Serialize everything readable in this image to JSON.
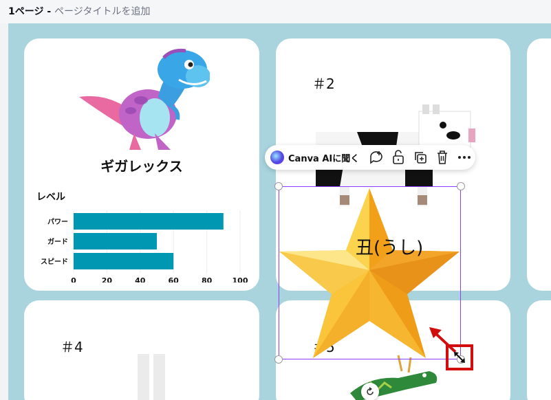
{
  "header": {
    "page_number": "1ページ",
    "separator": " - ",
    "page_title_placeholder": "ページタイトルを追加"
  },
  "cards": {
    "dino": {
      "name": "ギガレックス"
    },
    "card2": {
      "label": "＃2"
    },
    "card4": {
      "label": "＃4"
    },
    "card5": {
      "label": "＃5"
    }
  },
  "star_text": "丑(うし)",
  "toolbar": {
    "ai_label": "Canva AIに聞く",
    "icons": [
      "canva-ai-icon",
      "comment-add-icon",
      "unlock-icon",
      "duplicate-icon",
      "trash-icon",
      "more-icon"
    ]
  },
  "chart_data": {
    "type": "bar",
    "orientation": "horizontal",
    "title": "レベル",
    "categories": [
      "パワー",
      "ガード",
      "スピード"
    ],
    "values": [
      90,
      50,
      60
    ],
    "xlim": [
      0,
      100
    ],
    "xticks": [
      "0",
      "20",
      "40",
      "60",
      "80",
      "100"
    ],
    "grid": true,
    "color": "#0097b2"
  },
  "colors": {
    "canvas_bg": "#a9d4de",
    "selection": "#8b3dff",
    "highlight_red": "#d10d0d",
    "bar": "#0097b2"
  }
}
